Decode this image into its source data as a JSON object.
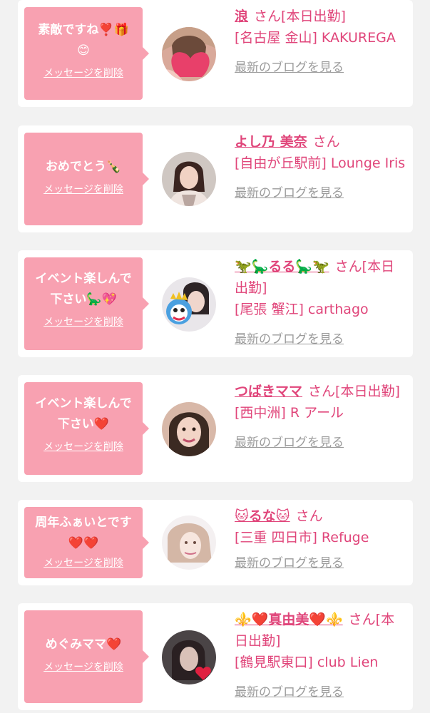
{
  "entries": [
    {
      "message": "素敵ですね❣️🎁\n😊",
      "delete_label": "メッセージを削除",
      "name": "浪",
      "san": "さん",
      "status": "[本日出勤]",
      "shop": "[名古屋 金山] KAKUREGA",
      "blog_label": "最新のブログを見る"
    },
    {
      "message": "おめでとう🍾",
      "delete_label": "メッセージを削除",
      "name": "よし乃 美奈",
      "san": "さん",
      "status": "",
      "shop": "[自由が丘駅前] Lounge Iris",
      "blog_label": "最新のブログを見る"
    },
    {
      "message": "イベント楽しんで\n下さい🦕💖",
      "delete_label": "メッセージを削除",
      "name": "🦖🦕るる🦕🦖",
      "san": "さん",
      "status": "[本日出勤]",
      "shop": "[尾張 蟹江] carthago",
      "blog_label": "最新のブログを見る"
    },
    {
      "message": "イベント楽しんで\n下さい❤️",
      "delete_label": "メッセージを削除",
      "name": "つばきママ",
      "san": "さん",
      "status": "[本日出勤]",
      "shop": "[西中洲] R アール",
      "blog_label": "最新のブログを見る"
    },
    {
      "message": "周年ふぁいとです\n❤️❤️",
      "delete_label": "メッセージを削除",
      "name": "🐱るな🐱",
      "san": "さん",
      "status": "",
      "shop": "[三重 四日市] Refuge",
      "blog_label": "最新のブログを見る"
    },
    {
      "message": "めぐみママ❤️",
      "delete_label": "メッセージを削除",
      "name": "⚜️❤️真由美❤️⚜️",
      "san": "さん",
      "status": "[本日出勤]",
      "shop": "[鶴見駅東口] club Lien",
      "blog_label": "最新のブログを見る"
    }
  ],
  "colors": {
    "bubble": "#f8a1b1",
    "accent": "#e0457a",
    "muted": "#9b9b9b",
    "background": "#f2f2f2"
  }
}
